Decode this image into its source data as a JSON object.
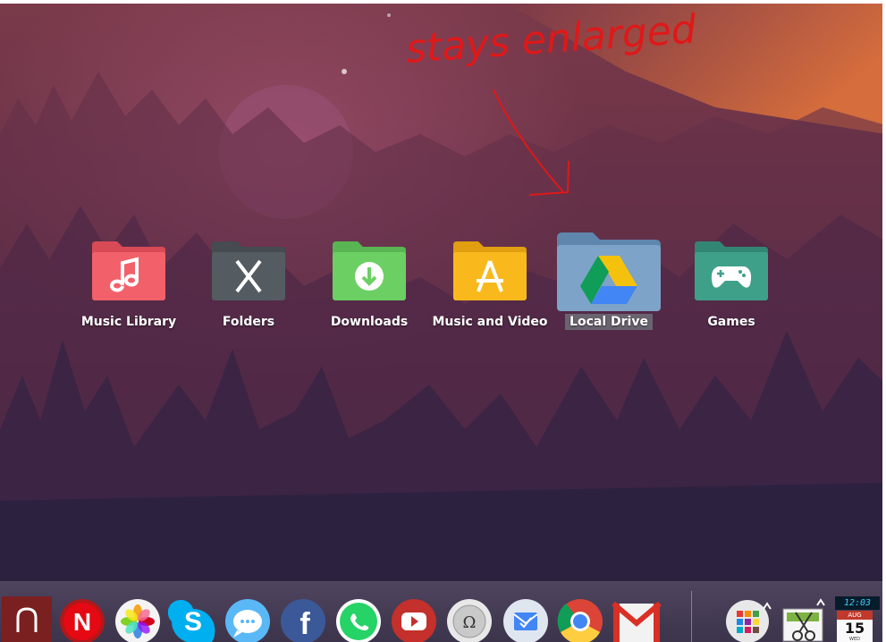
{
  "annotation": {
    "text": "stays enlarged",
    "color": "#e01818"
  },
  "folders": [
    {
      "label": "Music Library",
      "icon": "music-note-icon",
      "color": "#f2606a"
    },
    {
      "label": "Folders",
      "icon": "x-letter-icon",
      "color": "#555c61"
    },
    {
      "label": "Downloads",
      "icon": "download-arrow-icon",
      "color": "#6ccf63"
    },
    {
      "label": "Music and Video",
      "icon": "app-store-icon",
      "color": "#f9b91d"
    },
    {
      "label": "Local Drive",
      "icon": "google-drive-icon",
      "color": "#7ea3c8",
      "enlarged": true,
      "selected": true
    },
    {
      "label": "Games",
      "icon": "gamepad-icon",
      "color": "#3fa08a"
    }
  ],
  "dock": {
    "apps": [
      "music-app-icon",
      "netflix-icon",
      "photos-icon",
      "skype-icon",
      "messages-icon",
      "facebook-icon",
      "whatsapp-icon",
      "youtube-icon",
      "wikipedia-icon",
      "inbox-mail-icon",
      "chrome-icon",
      "gmail-icon"
    ],
    "tray": [
      "app-grid-icon",
      "snipping-tool-icon",
      "clock-calendar-widget"
    ],
    "netflix_letter": "N",
    "facebook_letter": "f",
    "skype_letter": "S",
    "wikipedia_letter": "Ω",
    "clock": {
      "time": "12:03",
      "month": "AUG",
      "day": "15",
      "weekday": "WED"
    }
  }
}
